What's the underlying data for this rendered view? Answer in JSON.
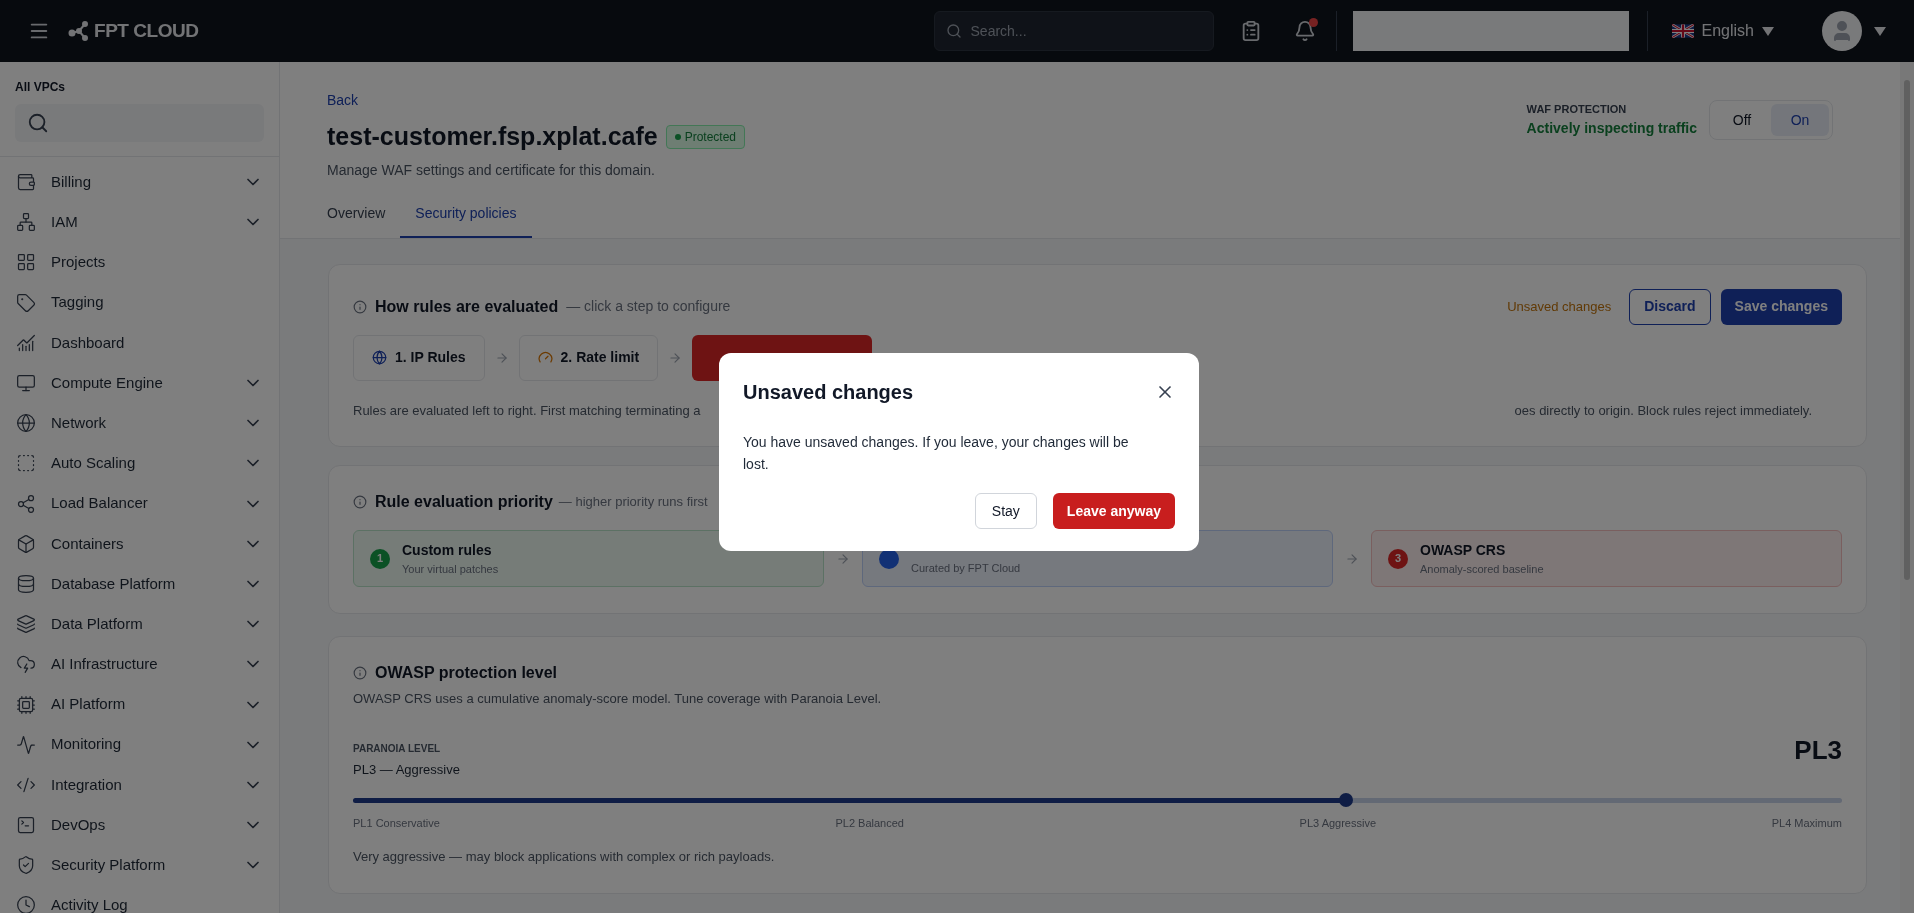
{
  "topbar": {
    "brand": "FPT CLOUD",
    "search": {
      "placeholder": "Search..."
    },
    "notification_badge": true,
    "language": "English"
  },
  "sidebar": {
    "vpc_label": "All VPCs",
    "items": [
      {
        "label": "Billing",
        "expandable": true
      },
      {
        "label": "IAM",
        "expandable": true
      },
      {
        "label": "Projects",
        "expandable": false
      },
      {
        "label": "Tagging",
        "expandable": false
      },
      {
        "label": "Dashboard",
        "expandable": false
      },
      {
        "label": "Compute Engine",
        "expandable": true
      },
      {
        "label": "Network",
        "expandable": true
      },
      {
        "label": "Auto Scaling",
        "expandable": true
      },
      {
        "label": "Load Balancer",
        "expandable": true
      },
      {
        "label": "Containers",
        "expandable": true
      },
      {
        "label": "Database Platform",
        "expandable": true
      },
      {
        "label": "Data Platform",
        "expandable": true
      },
      {
        "label": "AI Infrastructure",
        "expandable": true
      },
      {
        "label": "AI Platform",
        "expandable": true
      },
      {
        "label": "Monitoring",
        "expandable": true
      },
      {
        "label": "Integration",
        "expandable": true
      },
      {
        "label": "DevOps",
        "expandable": true
      },
      {
        "label": "Security Platform",
        "expandable": true
      },
      {
        "label": "Activity Log",
        "expandable": false
      }
    ]
  },
  "header": {
    "back": "Back",
    "title": "test-customer.fsp.xplat.cafe",
    "status": "Protected",
    "subtitle": "Manage WAF settings and certificate for this domain.",
    "waf": {
      "label": "WAF PROTECTION",
      "status": "Actively inspecting traffic",
      "options": [
        {
          "label": "Off",
          "selected": false
        },
        {
          "label": "On",
          "selected": true
        }
      ]
    }
  },
  "tabs": [
    {
      "label": "Overview",
      "selected": false
    },
    {
      "label": "Security policies",
      "selected": true
    }
  ],
  "rules_card": {
    "title": "How rules are evaluated",
    "hint": "— click a step to configure",
    "unsaved": "Unsaved changes",
    "discard": "Discard",
    "save": "Save changes",
    "steps": [
      {
        "kind": "normal",
        "label": "1. IP Rules"
      },
      {
        "kind": "normal",
        "label": "2. Rate limit"
      },
      {
        "kind": "danger"
      }
    ],
    "description_start": "Rules are evaluated left to right. First matching terminating a",
    "description_end": "oes directly to origin. Block rules reject immediately."
  },
  "priority_card": {
    "title": "Rule evaluation priority",
    "hint": "— higher priority runs first",
    "tiers": [
      {
        "number": "1",
        "title": "Custom rules",
        "subtitle": "Your virtual patches",
        "color": "#0b5125"
      },
      {
        "subtitle": "Curated by FPT Cloud",
        "color": "#123175"
      },
      {
        "number": "3",
        "title": "OWASP CRS",
        "subtitle": "Anomaly-scored baseline",
        "color": "#6e1313"
      }
    ]
  },
  "owasp_card": {
    "title": "OWASP protection level",
    "description": "OWASP CRS uses a cumulative anomaly-score model. Tune coverage with Paranoia Level.",
    "paranoia_label": "PARANOIA LEVEL",
    "current": "PL3 — Aggressive",
    "badge": "PL3",
    "slider": {
      "level": 0.667
    },
    "ticks": [
      "PL1 Conservative",
      "PL2 Balanced",
      "PL3 Aggressive",
      "PL4 Maximum"
    ],
    "note": "Very aggressive — may block applications with complex or rich payloads."
  },
  "modal": {
    "title": "Unsaved changes",
    "body": "You have unsaved changes. If you leave, your changes will be lost.",
    "stay": "Stay",
    "leave": "Leave anyway"
  }
}
